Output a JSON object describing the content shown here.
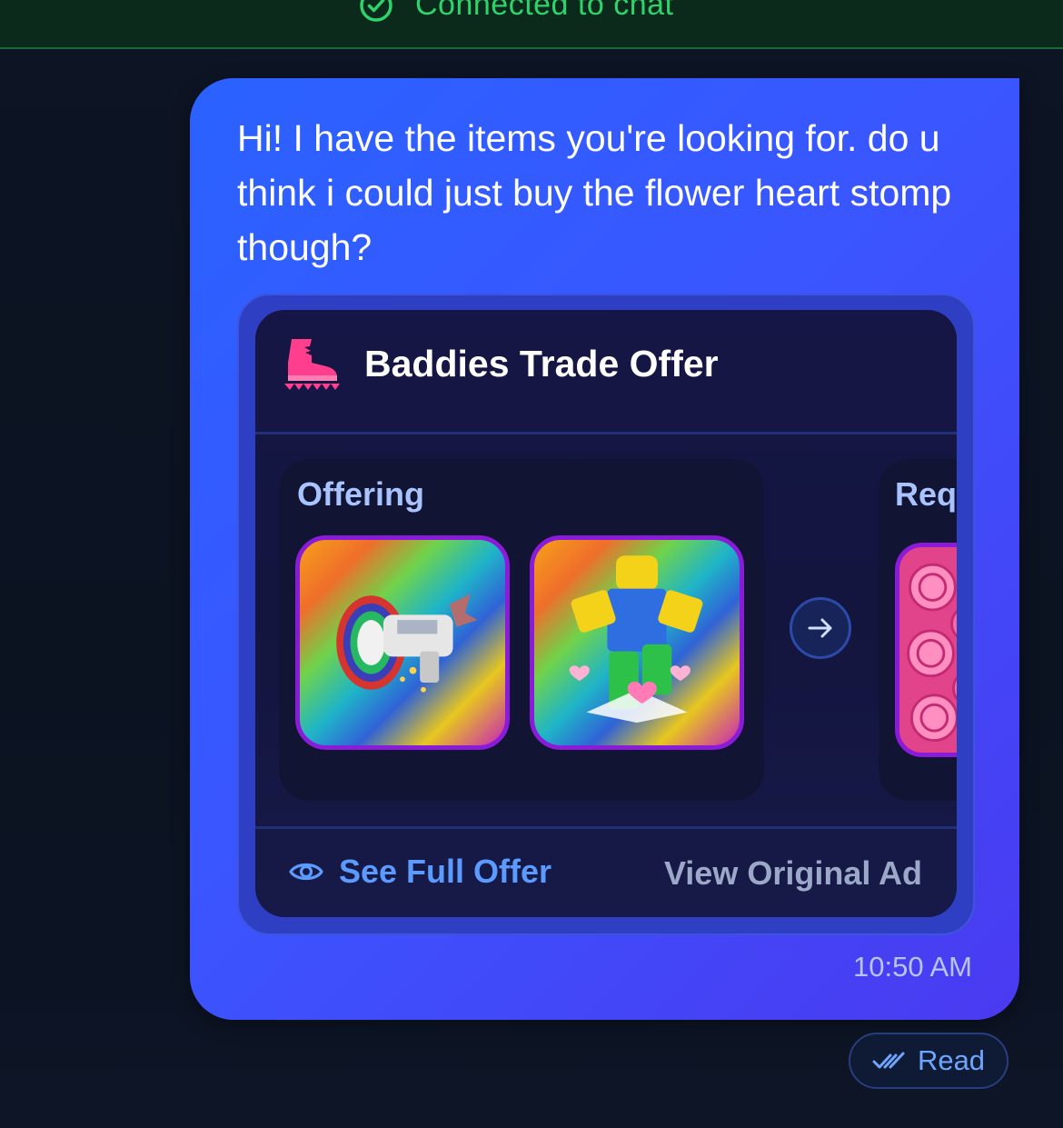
{
  "status": {
    "text": "Connected to chat",
    "icon": "check-circle-icon",
    "color": "#2ed36b"
  },
  "message": {
    "text": "Hi! I have the items you're looking for. do u think i could just buy the flower heart stomp though?",
    "timestamp": "10:50 AM",
    "read_label": "Read",
    "bubble_color": "#3a56ff"
  },
  "trade_card": {
    "title": "Baddies Trade Offer",
    "brand_icon": "boot-icon",
    "offering_label": "Offering",
    "requesting_label": "Requesting",
    "offering_items": [
      {
        "icon": "rainbow-blaster-item"
      },
      {
        "icon": "flower-heart-stomp-item"
      }
    ],
    "requesting_items": [
      {
        "icon": "pink-coins-item"
      }
    ],
    "see_full_offer_label": "See Full Offer",
    "view_original_ad_label": "View Original Ad"
  }
}
